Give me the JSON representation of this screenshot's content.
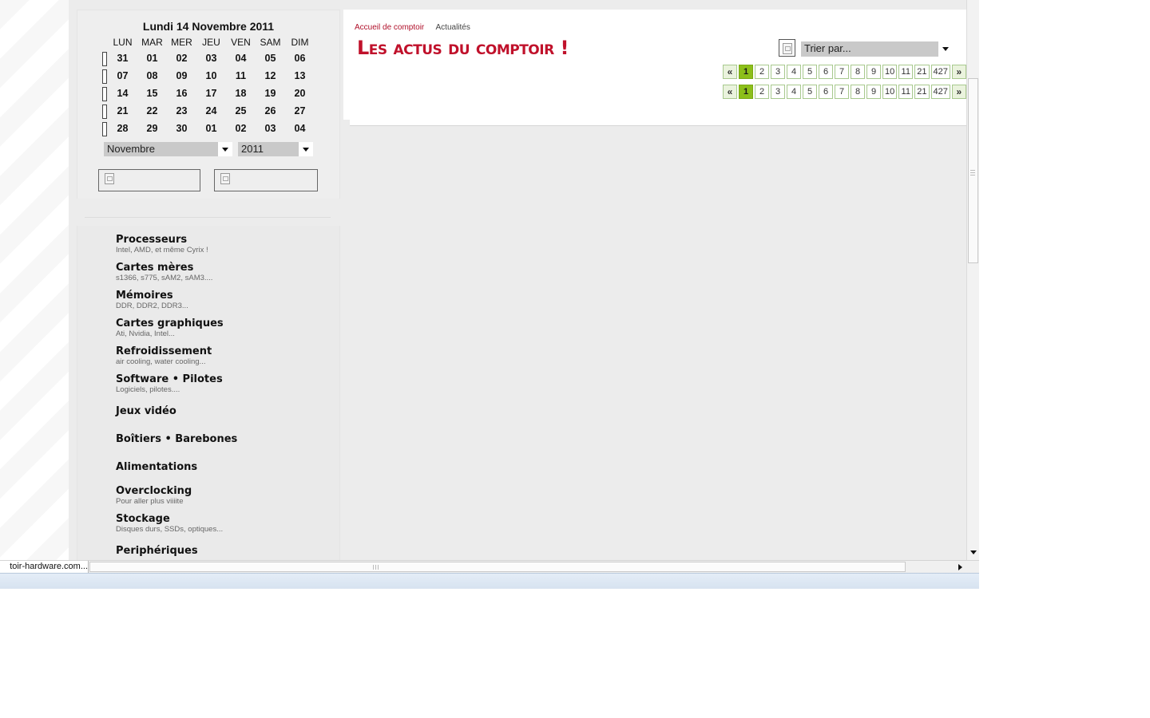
{
  "calendar": {
    "title": "Lundi 14 Novembre 2011",
    "weekdays": [
      "LUN",
      "MAR",
      "MER",
      "JEU",
      "VEN",
      "SAM",
      "DIM"
    ],
    "weeks": [
      [
        "31",
        "01",
        "02",
        "03",
        "04",
        "05",
        "06"
      ],
      [
        "07",
        "08",
        "09",
        "10",
        "11",
        "12",
        "13"
      ],
      [
        "14",
        "15",
        "16",
        "17",
        "18",
        "19",
        "20"
      ],
      [
        "21",
        "22",
        "23",
        "24",
        "25",
        "26",
        "27"
      ],
      [
        "28",
        "29",
        "30",
        "01",
        "02",
        "03",
        "04"
      ]
    ],
    "month_select": "Novembre",
    "year_select": "2011"
  },
  "menu": [
    {
      "title": "Processeurs",
      "subtitle": "Intel, AMD, et même Cyrix !"
    },
    {
      "title": "Cartes mères",
      "subtitle": "s1366, s775, sAM2, sAM3...."
    },
    {
      "title": "Mémoires",
      "subtitle": "DDR, DDR2, DDR3..."
    },
    {
      "title": "Cartes graphiques",
      "subtitle": "Ati, Nvidia, Intel..."
    },
    {
      "title": "Refroidissement",
      "subtitle": "air cooling, water cooling..."
    },
    {
      "title": "Software • Pilotes",
      "subtitle": "Logiciels, pilotes...."
    },
    {
      "title": "Jeux vidéo",
      "subtitle": ""
    },
    {
      "title": "Boîtiers • Barebones",
      "subtitle": ""
    },
    {
      "title": "Alimentations",
      "subtitle": ""
    },
    {
      "title": "Overclocking",
      "subtitle": "Pour aller plus viiiite"
    },
    {
      "title": "Stockage",
      "subtitle": "Disques durs, SSDs, optiques..."
    },
    {
      "title": "Periphériques",
      "subtitle": ""
    }
  ],
  "breadcrumb": {
    "home": "Accueil de comptoir",
    "current": "Actualités"
  },
  "heading": "Les actus du comptoir !",
  "sort": {
    "label": "Trier par..."
  },
  "pagination": {
    "prev": "«",
    "next": "»",
    "pages": [
      "1",
      "2",
      "3",
      "4",
      "5",
      "6",
      "7",
      "8",
      "9",
      "10",
      "11",
      "21",
      "427"
    ],
    "current": "1"
  },
  "status_bar": {
    "url": "toir-hardware.com..."
  }
}
